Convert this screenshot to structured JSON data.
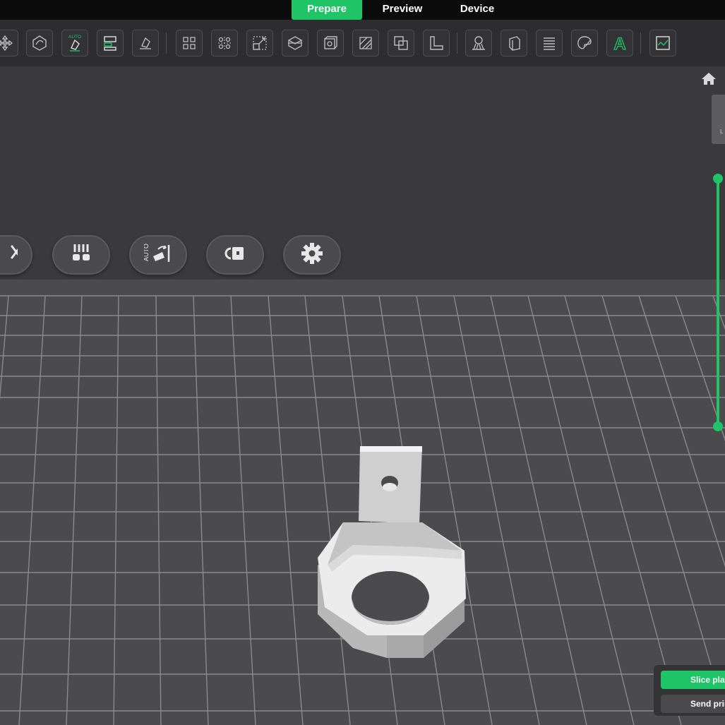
{
  "tabs": [
    {
      "label": "Prepare",
      "active": true
    },
    {
      "label": "Preview",
      "active": false
    },
    {
      "label": "Device",
      "active": false
    }
  ],
  "toolbar": {
    "icons": [
      "move-icon",
      "rotate-icon",
      "auto-orient-icon",
      "arrange-icon",
      "lay-on-face-icon",
      "split-to-objects-icon",
      "split-to-parts-icon",
      "scale-icon",
      "cut-icon",
      "hollow-icon",
      "variable-layer-height-icon",
      "boolean-icon",
      "measure-icon",
      "support-painting-icon",
      "seam-painting-icon",
      "fuzzy-skin-icon",
      "color-painting-icon",
      "text-icon",
      "assembly-icon"
    ],
    "auto_badge": "AUTO",
    "text_tool_glyph": "A"
  },
  "floating_buttons": [
    "clear-plate-icon",
    "filament-settings-icon",
    "auto-arrange-icon",
    "lock-plate-icon",
    "plate-settings-icon"
  ],
  "floating_auto_label": "AUTO",
  "side_tab_label": "L",
  "actions": {
    "slice_label": "Slice plate",
    "send_label": "Send print"
  },
  "colors": {
    "accent": "#1fc467",
    "toolbar_bg": "#2d2d2f",
    "plate_bg": "#4b4b4e",
    "grid_line": "#8a8a8d",
    "model": "#e6e6e6"
  }
}
